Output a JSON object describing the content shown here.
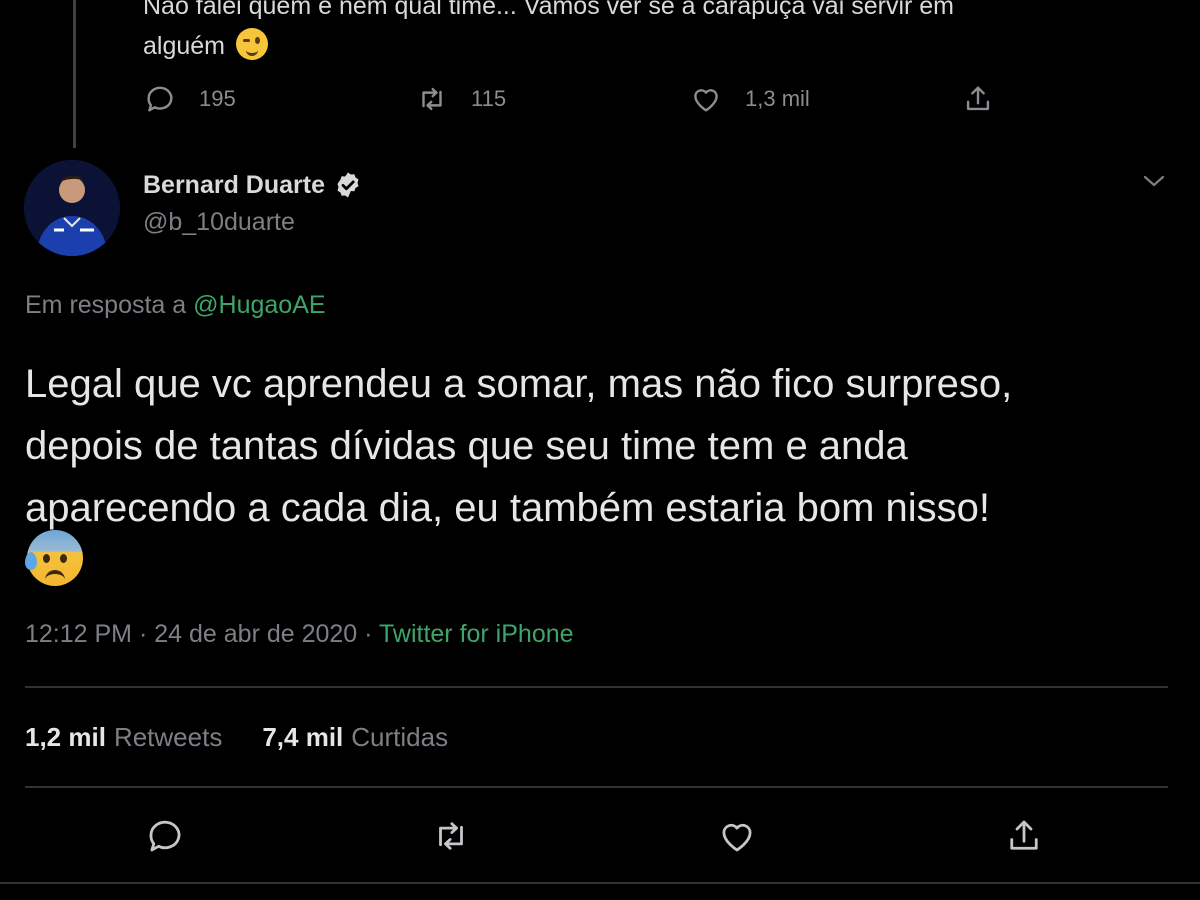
{
  "parent_tweet": {
    "text_line1": "Não falei quem e nem qual time... Vamos ver se a carapuça vai servir em",
    "text_line2": "alguém",
    "emoji": "winking-face",
    "replies": "195",
    "retweets": "115",
    "likes": "1,3 mil"
  },
  "author": {
    "name": "Bernard Duarte",
    "handle": "@b_10duarte",
    "verified": true
  },
  "reply_context": {
    "prefix": "Em resposta a",
    "mention": "@HugaoAE"
  },
  "tweet": {
    "lines": [
      "Legal que vc aprendeu a somar, mas não fico surpreso,",
      "depois de tantas dívidas que seu time tem e anda",
      "aparecendo a cada dia, eu também estaria bom nisso!"
    ],
    "emoji": "anxious-face-with-sweat",
    "time": "12:12 PM",
    "date": "24 de abr de 2020",
    "separator": "·",
    "source": "Twitter for iPhone"
  },
  "stats": {
    "retweets_count": "1,2 mil",
    "retweets_label": "Retweets",
    "likes_count": "7,4 mil",
    "likes_label": "Curtidas"
  },
  "icons": {
    "reply": "reply-icon",
    "retweet": "retweet-icon",
    "like": "heart-icon",
    "share": "share-icon",
    "more": "chevron-down-icon",
    "verified": "verified-badge-icon"
  },
  "colors": {
    "background": "#000000",
    "text": "#d9d9d9",
    "muted": "#7c8085",
    "accent": "#3ea56a",
    "divider": "#2f3336"
  }
}
